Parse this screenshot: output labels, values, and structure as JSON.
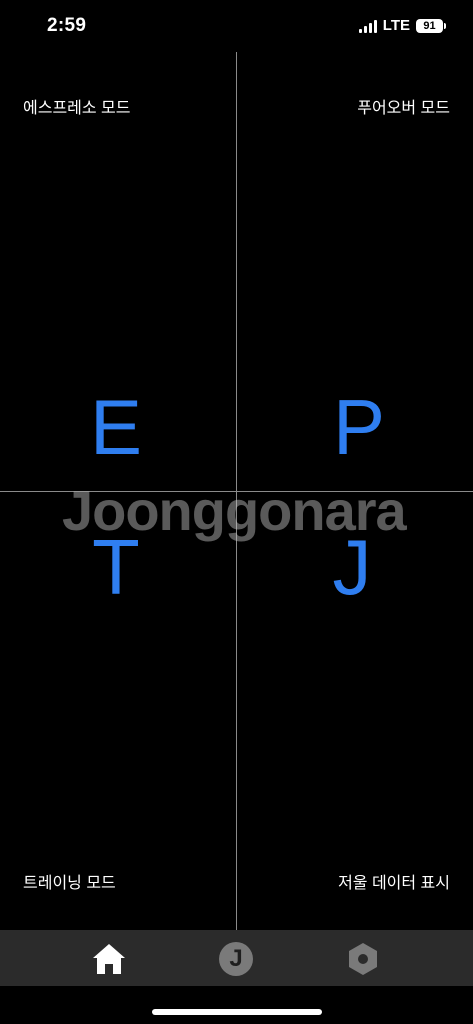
{
  "status_bar": {
    "time": "2:59",
    "network": "LTE",
    "battery": "91"
  },
  "quadrants": {
    "top_left": {
      "label": "에스프레소 모드",
      "letter": "E"
    },
    "top_right": {
      "label": "푸어오버 모드",
      "letter": "P"
    },
    "bottom_left": {
      "label": "트레이닝 모드",
      "letter": "T"
    },
    "bottom_right": {
      "label": "저울 데이터 표시",
      "letter": "J"
    }
  },
  "watermark": "Joonggonara",
  "tab_bar": {
    "items": [
      {
        "icon": "home-icon",
        "active": true
      },
      {
        "icon": "j-logo-icon",
        "glyph": "J"
      },
      {
        "icon": "settings-nut-icon"
      }
    ]
  },
  "colors": {
    "accent": "#2f7ef0",
    "background": "#000000",
    "tab_bar": "#2b2b2b",
    "divider": "#8a8a8a"
  }
}
